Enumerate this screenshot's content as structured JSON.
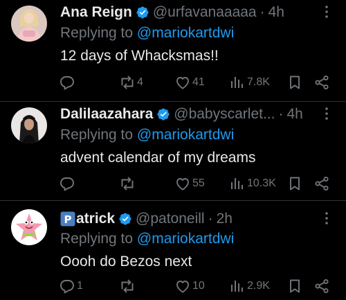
{
  "colors": {
    "background": "#000000",
    "text_primary": "#e7e9ea",
    "text_secondary": "#71767b",
    "accent_blue": "#1d9bf0",
    "divider": "#2f3336"
  },
  "replies": [
    {
      "name": "Ana Reign",
      "verified": true,
      "handle": "@urfavanaaaaa",
      "separator": "·",
      "time": "4h",
      "replying_prefix": "Replying to",
      "replying_to": "@mariokartdwi",
      "text": "12 days of Whacksmas!!",
      "actions": {
        "reply_count": "",
        "repost_count": "4",
        "like_count": "41",
        "views_count": "7.8K"
      }
    },
    {
      "name": "Dalilaazahara",
      "verified": true,
      "handle": "@babyscarlet...",
      "separator": "·",
      "time": "4h",
      "replying_prefix": "Replying to",
      "replying_to": "@mariokartdwi",
      "text": "advent calendar of my dreams",
      "actions": {
        "reply_count": "",
        "repost_count": "",
        "like_count": "55",
        "views_count": "10.3K"
      }
    },
    {
      "name_prefix_icon": "P",
      "name": "atrick",
      "verified": true,
      "handle": "@patoneill",
      "separator": "·",
      "time": "2h",
      "replying_prefix": "Replying to",
      "replying_to": "@mariokartdwi",
      "text": "Oooh do Bezos next",
      "actions": {
        "reply_count": "1",
        "repost_count": "",
        "like_count": "10",
        "views_count": "2.9K"
      }
    }
  ],
  "icons": {
    "more": "more-dots-icon",
    "verified": "verified-badge-icon",
    "reply": "reply-bubble-icon",
    "repost": "repost-icon",
    "like": "heart-icon",
    "views": "views-bar-chart-icon",
    "bookmark": "bookmark-icon",
    "share": "share-icon"
  }
}
